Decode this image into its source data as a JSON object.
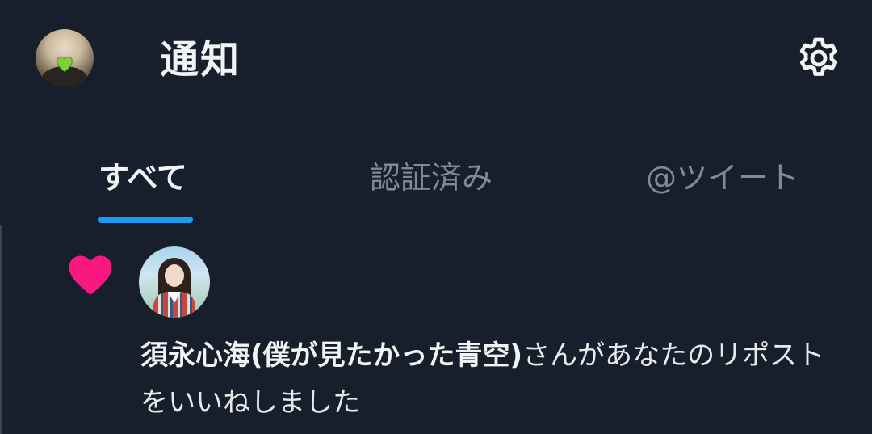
{
  "header": {
    "title": "通知"
  },
  "tabs": [
    {
      "label": "すべて",
      "selected": true
    },
    {
      "label": "認証済み",
      "selected": false
    },
    {
      "label": "@ツイート",
      "selected": false
    }
  ],
  "notification": {
    "type": "like",
    "user_name": "須永心海(僕が見たかった青空)",
    "text": "さんがあなたのリポストをいいねしました"
  },
  "colors": {
    "background": "#161f2b",
    "accent": "#1d9bf0",
    "like": "#f91880",
    "inactive_tab": "#7f8a96"
  },
  "icons": {
    "settings": "gear-icon",
    "like": "heart-icon"
  }
}
